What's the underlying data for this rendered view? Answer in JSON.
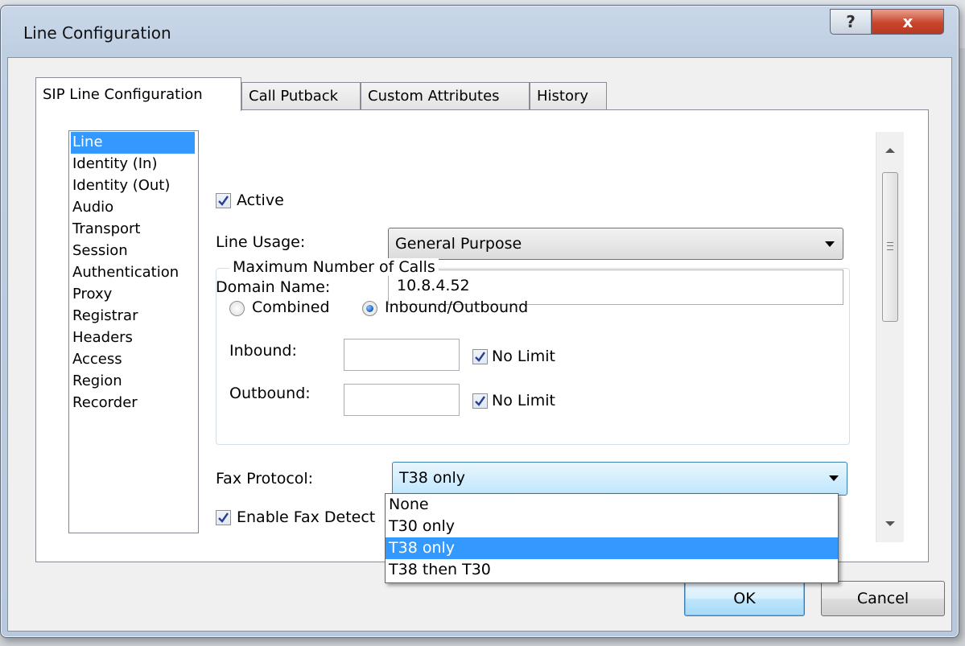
{
  "window": {
    "title": "Line Configuration",
    "help_glyph": "?",
    "close_glyph": "x"
  },
  "tabs": [
    {
      "label": "SIP Line Configuration",
      "active": true
    },
    {
      "label": "Call Putback",
      "active": false
    },
    {
      "label": "Custom Attributes",
      "active": false
    },
    {
      "label": "History",
      "active": false
    }
  ],
  "nav": {
    "selected": "Line",
    "items": [
      "Line",
      "Identity (In)",
      "Identity (Out)",
      "Audio",
      "Transport",
      "Session",
      "Authentication",
      "Proxy",
      "Registrar",
      "Headers",
      "Access",
      "Region",
      "Recorder"
    ]
  },
  "form": {
    "active": {
      "label": "Active",
      "checked": true
    },
    "line_usage": {
      "label": "Line Usage:",
      "value": "General Purpose"
    },
    "domain_name": {
      "label": "Domain Name:",
      "value": "10.8.4.52"
    },
    "max_calls": {
      "title": "Maximum Number of Calls",
      "combined_label": "Combined",
      "inbound_outbound_label": "Inbound/Outbound",
      "mode": "Inbound/Outbound",
      "inbound": {
        "label": "Inbound:",
        "value": "",
        "no_limit_label": "No Limit",
        "no_limit": true
      },
      "outbound": {
        "label": "Outbound:",
        "value": "",
        "no_limit_label": "No Limit",
        "no_limit": true
      }
    },
    "fax_protocol": {
      "label": "Fax Protocol:",
      "value": "T38 only",
      "options": [
        "None",
        "T30 only",
        "T38 only",
        "T38 then T30"
      ]
    },
    "fax_detection": {
      "label": "Enable Fax Detect",
      "checked": true
    }
  },
  "buttons": {
    "ok": "OK",
    "cancel": "Cancel"
  },
  "colors": {
    "selection": "#3399ff",
    "close_button": "#c8452d",
    "window_frame": "#bfcfe2"
  }
}
